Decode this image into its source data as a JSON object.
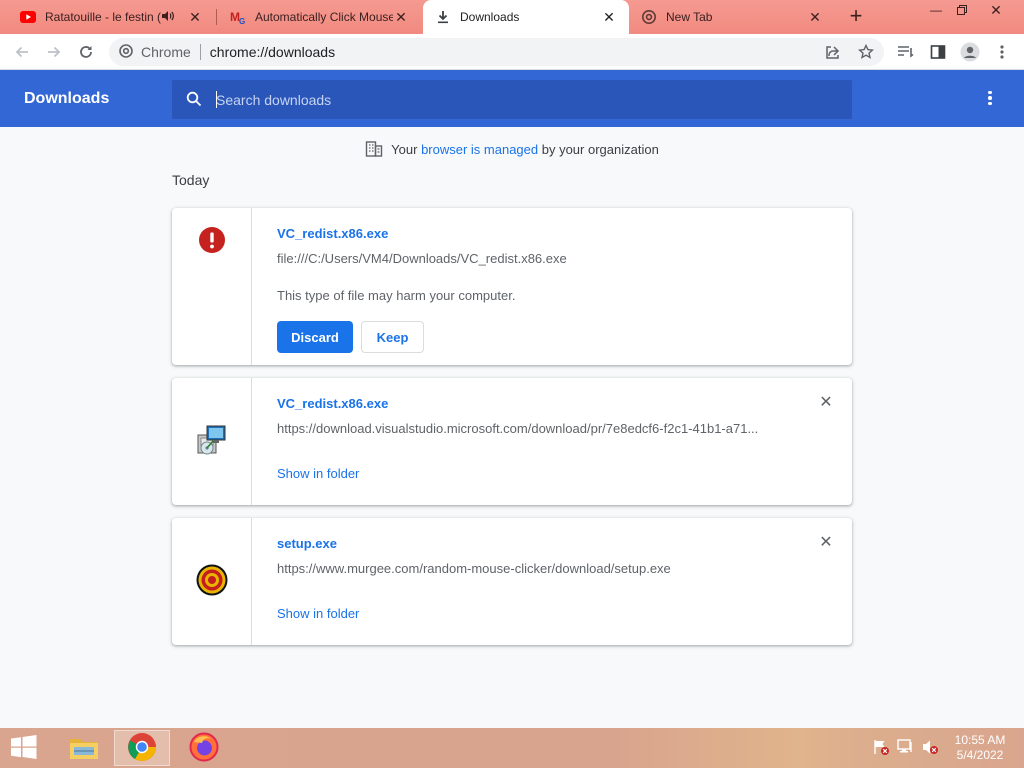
{
  "tabs": [
    {
      "title": "Ratatouille - le festin (",
      "icon": "youtube-icon"
    },
    {
      "title": "Automatically Click Mouse",
      "icon": "murgee-icon"
    },
    {
      "title": "Downloads",
      "icon": "download-icon"
    },
    {
      "title": "New Tab",
      "icon": "chrome-icon"
    }
  ],
  "toolbar": {
    "omnibox_label": "Chrome",
    "url": "chrome://downloads"
  },
  "header": {
    "title": "Downloads",
    "search_placeholder": "Search downloads"
  },
  "managed": {
    "prefix": "Your ",
    "link": "browser is managed",
    "suffix": " by your organization"
  },
  "date_group": "Today",
  "downloads": [
    {
      "name": "VC_redist.x86.exe",
      "url": "file:///C:/Users/VM4/Downloads/VC_redist.x86.exe",
      "warning": "This type of file may harm your computer.",
      "discard_label": "Discard",
      "keep_label": "Keep",
      "icon": "warning-icon"
    },
    {
      "name": "VC_redist.x86.exe",
      "url": "https://download.visualstudio.microsoft.com/download/pr/7e8edcf6-f2c1-41b1-a71...",
      "action_label": "Show in folder",
      "icon": "installer-icon"
    },
    {
      "name": "setup.exe",
      "url": "https://www.murgee.com/random-mouse-clicker/download/setup.exe",
      "action_label": "Show in folder",
      "icon": "target-icon"
    }
  ],
  "taskbar": {
    "time": "10:55 AM",
    "date": "5/4/2022"
  },
  "colors": {
    "tabstrip": "#f18a80",
    "header": "#3367d6",
    "link": "#1a73e8",
    "warning": "#c5221f"
  }
}
